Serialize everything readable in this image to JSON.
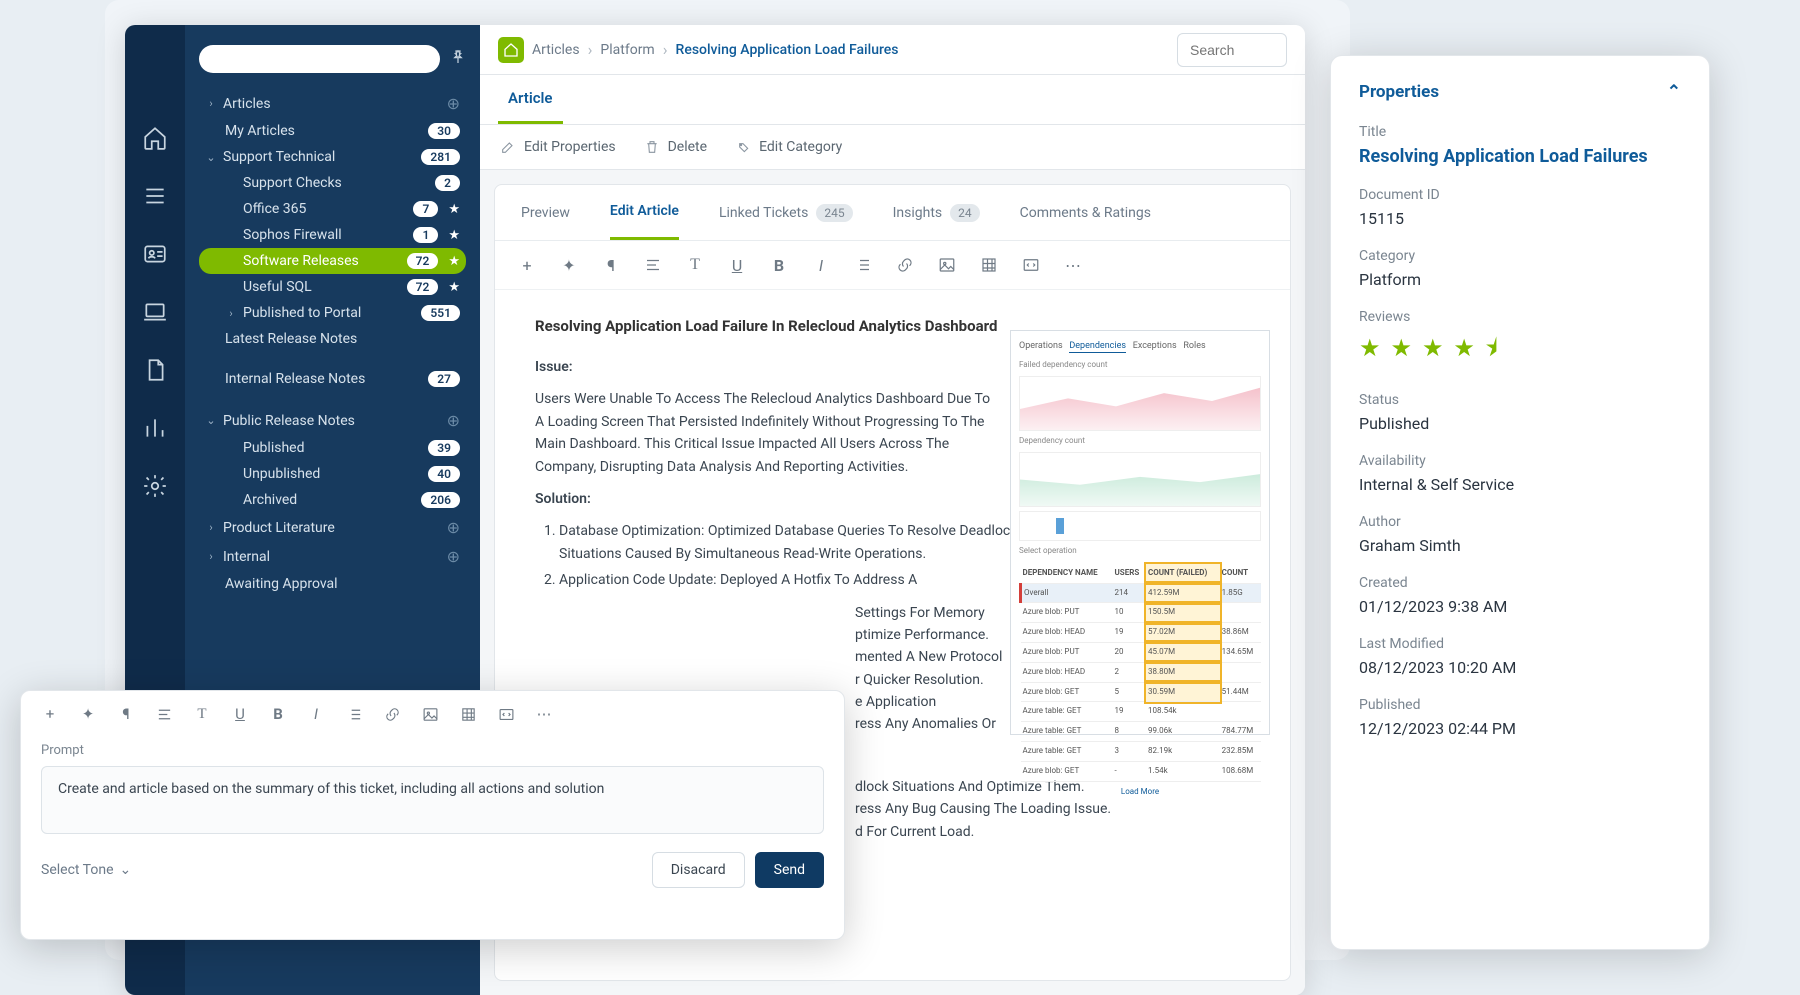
{
  "sidebar": {
    "articles": "Articles",
    "my_articles": {
      "label": "My Articles",
      "count": "30"
    },
    "support_technical": {
      "label": "Support Technical",
      "count": "281"
    },
    "support_checks": {
      "label": "Support Checks",
      "count": "2"
    },
    "office365": {
      "label": "Office 365",
      "count": "7"
    },
    "sophos": {
      "label": "Sophos Firewall",
      "count": "1"
    },
    "software_releases": {
      "label": "Software Releases",
      "count": "72"
    },
    "useful_sql": {
      "label": "Useful SQL",
      "count": "72"
    },
    "published_portal": {
      "label": "Published to Portal",
      "count": "551"
    },
    "latest_release": "Latest Release Notes",
    "internal_release": {
      "label": "Internal Release Notes",
      "count": "27"
    },
    "public_release": "Public Release Notes",
    "published": {
      "label": "Published",
      "count": "39"
    },
    "unpublished": {
      "label": "Unpublished",
      "count": "40"
    },
    "archived": {
      "label": "Archived",
      "count": "206"
    },
    "product_lit": "Product Literature",
    "internal": "Internal",
    "awaiting": "Awaiting Approval"
  },
  "breadcrumb": {
    "c1": "Articles",
    "c2": "Platform",
    "c3": "Resolving Application Load Failures"
  },
  "search_placeholder": "Search",
  "tab_article": "Article",
  "actions": {
    "edit_prop": "Edit Properties",
    "delete": "Delete",
    "edit_cat": "Edit Category"
  },
  "tabs2": {
    "preview": "Preview",
    "edit": "Edit Article",
    "linked": "Linked Tickets",
    "linked_count": "245",
    "insights": "Insights",
    "insights_count": "24",
    "comments": "Comments & Ratings"
  },
  "article": {
    "title": "Resolving Application Load Failure In Relecloud Analytics Dashboard",
    "issue_label": "Issue:",
    "issue_text": "Users Were Unable To Access The Relecloud Analytics Dashboard Due To A Loading Screen That Persisted Indefinitely Without Progressing To The Main Dashboard. This Critical Issue Impacted All Users Across The Company, Disrupting Data Analysis And Reporting Activities.",
    "solution_label": "Solution:",
    "sol1": "Database Optimization: Optimized Database Queries To Resolve Deadlock Situations Caused By Simultaneous Read-Write Operations.",
    "sol2": "Application Code Update: Deployed A Hotfix To Address A",
    "sol_tail1": "Settings For Memory",
    "sol_tail2": "ptimize Performance.",
    "sol_tail3": "mented A New Protocol",
    "sol_tail4": "r Quicker Resolution.",
    "sol_tail5": "e Application",
    "sol_tail6": "ress Any Anomalies Or",
    "bul1": "dlock Situations And Optimize Them.",
    "bul2": "ress Any Bug Causing The Loading Issue.",
    "bul3": "d For Current Load."
  },
  "chart": {
    "tabs": {
      "ops": "Operations",
      "deps": "Dependencies",
      "exc": "Exceptions",
      "roles": "Roles"
    },
    "h1": "Failed dependency count",
    "h2": "Dependency count",
    "tbl_h": {
      "name": "DEPENDENCY NAME",
      "users": "USERS",
      "cf": "COUNT (FAILED)",
      "count": "COUNT"
    },
    "overall": {
      "name": "Overall",
      "users": "214",
      "cf": "412.59M",
      "count": "1.85G"
    },
    "rows": [
      {
        "name": "Azure blob: PUT",
        "users": "10",
        "cf": "150.5M",
        "count": ""
      },
      {
        "name": "Azure blob: HEAD",
        "users": "19",
        "cf": "57.02M",
        "count": "38.86M"
      },
      {
        "name": "Azure blob: PUT",
        "users": "20",
        "cf": "45.07M",
        "count": "134.65M"
      },
      {
        "name": "Azure blob: HEAD",
        "users": "2",
        "cf": "38.80M",
        "count": ""
      },
      {
        "name": "Azure blob: GET",
        "users": "5",
        "cf": "30.59M",
        "count": "51.44M"
      },
      {
        "name": "Azure table: GET",
        "users": "19",
        "cf": "108.54k",
        "count": ""
      },
      {
        "name": "Azure table: GET",
        "users": "8",
        "cf": "99.06k",
        "count": "784.77M"
      },
      {
        "name": "Azure table: GET",
        "users": "3",
        "cf": "82.19k",
        "count": "232.85M"
      },
      {
        "name": "Azure blob: GET",
        "users": "-",
        "cf": "1.54k",
        "count": "108.68M"
      }
    ],
    "load_more": "Load More"
  },
  "props": {
    "header": "Properties",
    "title_lbl": "Title",
    "title_val": "Resolving Application Load Failures",
    "docid_lbl": "Document ID",
    "docid_val": "15115",
    "cat_lbl": "Category",
    "cat_val": "Platform",
    "reviews_lbl": "Reviews",
    "status_lbl": "Status",
    "status_val": "Published",
    "avail_lbl": "Availability",
    "avail_val": "Internal & Self Service",
    "author_lbl": "Author",
    "author_val": "Graham Simth",
    "created_lbl": "Created",
    "created_val": "01/12/2023 9:38 AM",
    "modified_lbl": "Last Modified",
    "modified_val": "08/12/2023 10:20 AM",
    "published_lbl": "Published",
    "published_val": "12/12/2023 02:44 PM"
  },
  "prompt": {
    "label": "Prompt",
    "text": "Create and article based on the summary of this ticket, including all actions and solution",
    "select_tone": "Select Tone",
    "discard": "Disacard",
    "send": "Send"
  }
}
